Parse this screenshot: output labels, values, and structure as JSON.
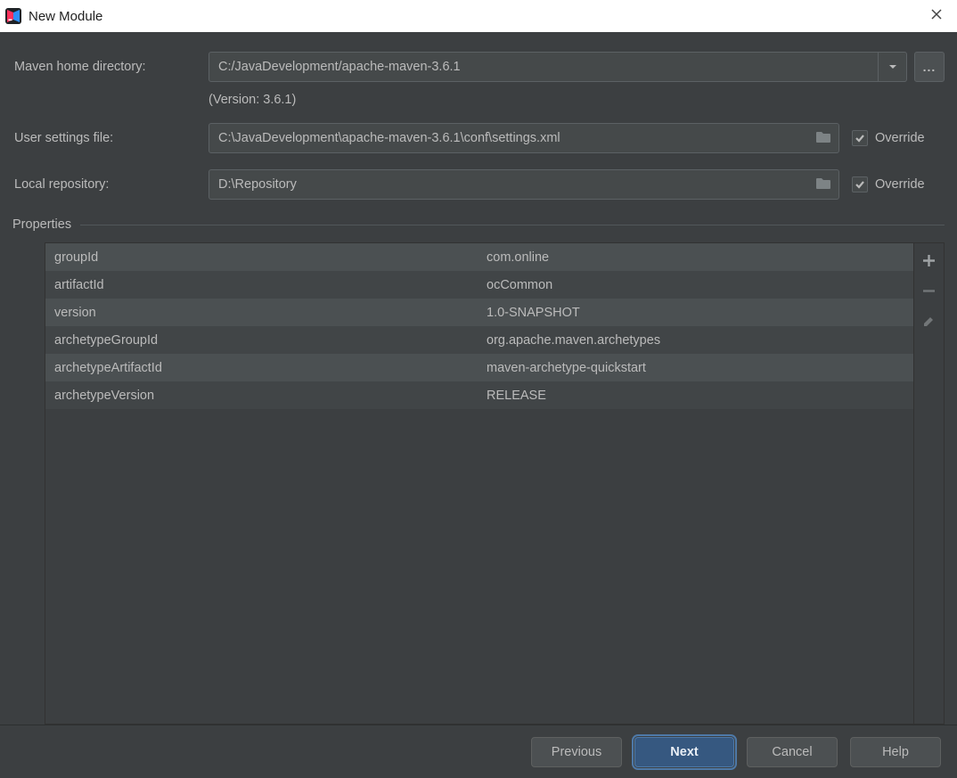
{
  "window": {
    "title": "New Module"
  },
  "form": {
    "maven_home_label": "Maven home directory:",
    "maven_home_value": "C:/JavaDevelopment/apache-maven-3.6.1",
    "version_info": "(Version: 3.6.1)",
    "user_settings_label": "User settings file:",
    "user_settings_value": "C:\\JavaDevelopment\\apache-maven-3.6.1\\conf\\settings.xml",
    "user_settings_override_label": "Override",
    "user_settings_override_checked": true,
    "local_repo_label": "Local repository:",
    "local_repo_value": "D:\\Repository",
    "local_repo_override_label": "Override",
    "local_repo_override_checked": true,
    "browse_glyph": "..."
  },
  "properties": {
    "title": "Properties",
    "rows": [
      {
        "key": "groupId",
        "value": "com.online"
      },
      {
        "key": "artifactId",
        "value": "ocCommon"
      },
      {
        "key": "version",
        "value": "1.0-SNAPSHOT"
      },
      {
        "key": "archetypeGroupId",
        "value": "org.apache.maven.archetypes"
      },
      {
        "key": "archetypeArtifactId",
        "value": "maven-archetype-quickstart"
      },
      {
        "key": "archetypeVersion",
        "value": "RELEASE"
      }
    ]
  },
  "footer": {
    "previous": "Previous",
    "next": "Next",
    "cancel": "Cancel",
    "help": "Help"
  }
}
